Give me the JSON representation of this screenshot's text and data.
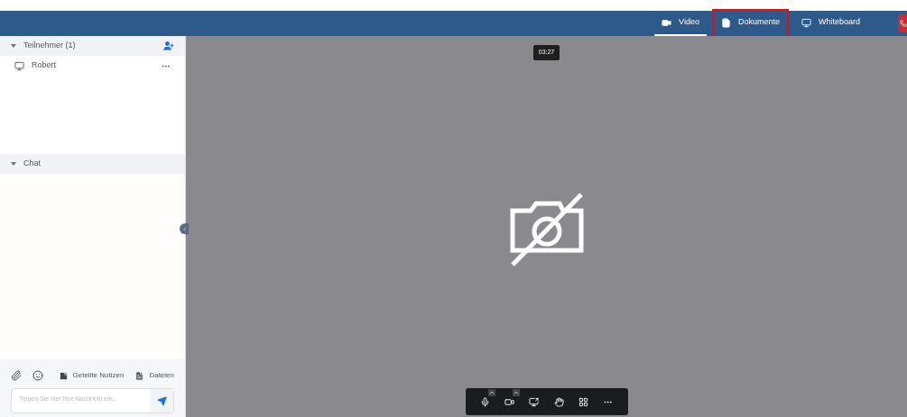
{
  "header": {
    "tabs": [
      {
        "kind": "video",
        "label": "Video",
        "selected": true,
        "highlighted": false
      },
      {
        "kind": "document",
        "label": "Dokumente",
        "selected": false,
        "highlighted": true
      },
      {
        "kind": "whiteboard",
        "label": "Whiteboard",
        "selected": false,
        "highlighted": false
      }
    ]
  },
  "sidebar": {
    "participants": {
      "title": "Teilnehmer (1)",
      "expanded": true,
      "items": [
        {
          "name": "Robert"
        }
      ]
    },
    "chat": {
      "title": "Chat",
      "expanded": true
    },
    "toolbar": {
      "buttons": [
        {
          "kind": "notes",
          "label": "Geteilte Notizen"
        },
        {
          "kind": "files",
          "label": "Dateien"
        }
      ]
    },
    "message": {
      "placeholder": "Tippen Sie hier Ihre Nachricht ein..."
    }
  },
  "stage": {
    "timer": "03:27",
    "camera_off": true
  }
}
